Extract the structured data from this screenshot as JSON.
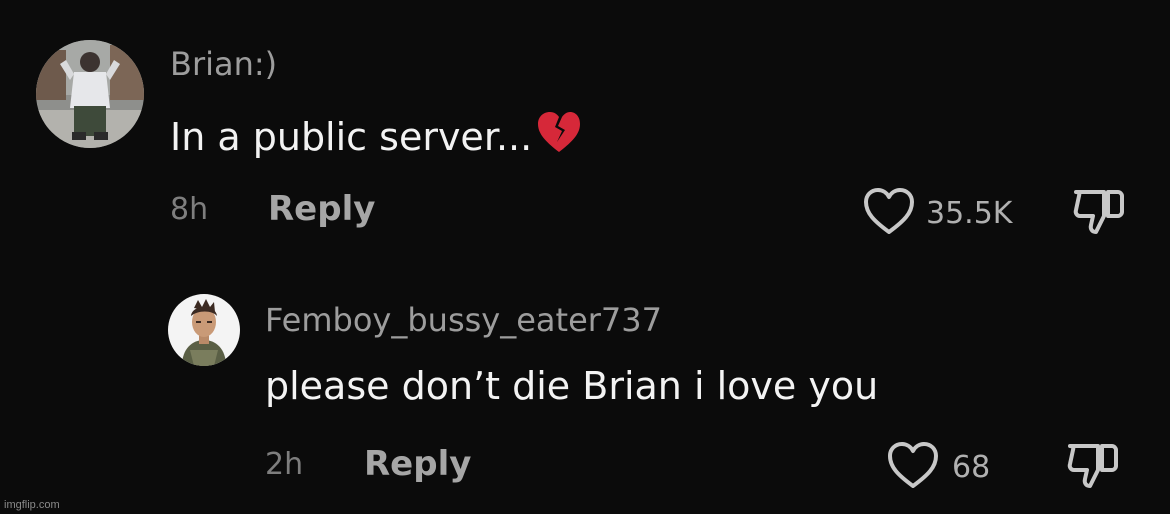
{
  "comments": [
    {
      "username": "Brian:)",
      "text": "In a public server...",
      "emoji": "broken-heart-icon",
      "time": "8h",
      "reply_label": "Reply",
      "likes": "35.5K"
    },
    {
      "username": "Femboy_bussy_eater737",
      "text": "please don’t die Brian i love you",
      "time": "2h",
      "reply_label": "Reply",
      "likes": "68"
    }
  ],
  "watermark": "imgflip.com",
  "colors": {
    "background": "#0b0b0b",
    "username": "#9d9d9d",
    "text": "#f3f3f3",
    "muted": "#7e7e7e",
    "icon": "#c8c8c8",
    "broken_heart": "#d62839"
  }
}
